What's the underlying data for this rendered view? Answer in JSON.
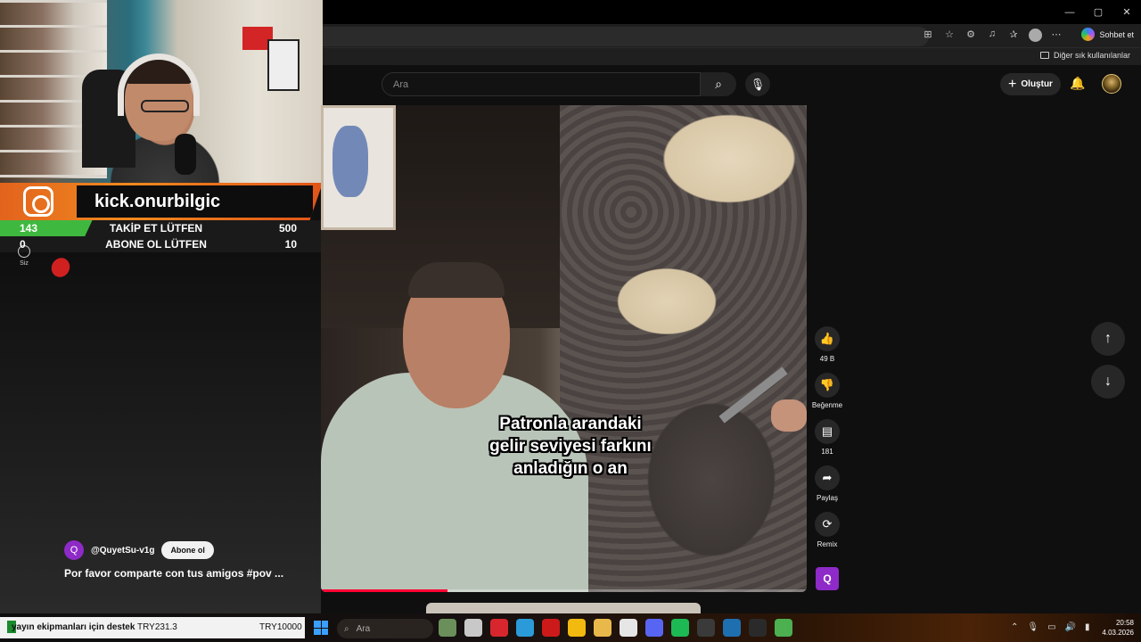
{
  "browser": {
    "window_controls": [
      "—",
      "▢",
      "✕"
    ],
    "copilot_label": "Sohbet et",
    "bookmarks_folder": "Diğer sık kullanılanlar"
  },
  "youtube": {
    "search_placeholder": "Ara",
    "create_label": "Oluştur"
  },
  "overlay": {
    "kick_handle": "kick.onurbilgic",
    "goals": [
      {
        "current": "143",
        "label": "TAKİP ET LÜTFEN",
        "target": "500",
        "fraction": 0.286
      },
      {
        "current": "0",
        "label": "ABONE OL LÜTFEN",
        "target": "10",
        "fraction": 0.0
      }
    ],
    "siz_label": "Siz"
  },
  "short": {
    "caption_lines": [
      "Patronla arandaki",
      "gelir seviyesi farkını",
      "anladığın o an"
    ],
    "channel_initial": "Q",
    "channel_name": "@QuyetSu-v1g",
    "subscribe_label": "Abone ol",
    "title": "Por favor comparte con tus amigos #pov ...",
    "progress_fraction": 0.26
  },
  "actions": {
    "like_count": "49 B",
    "dislike_label": "Beğenme",
    "comment_count": "181",
    "share_label": "Paylaş",
    "remix_label": "Remix",
    "avatar_initial": "Q"
  },
  "taskbar": {
    "ticker_text": "yayın ekipmanları için destek",
    "ticker_value": "TRY231.3",
    "ticker_goal": "TRY10000",
    "search_placeholder": "Ara",
    "time": "20:58",
    "date": "4.03.2026"
  },
  "colors": {
    "accent_red": "#ff0033",
    "kick_orange": "#f08a1e",
    "goal_green": "#3fb83f",
    "channel_purple": "#8e2ac7"
  },
  "icons": [
    "search-icon",
    "mic-icon",
    "bell-icon",
    "like-icon",
    "dislike-icon",
    "comment-icon",
    "share-icon",
    "remix-icon",
    "arrow-up-icon",
    "arrow-down-icon",
    "windows-start-icon"
  ]
}
